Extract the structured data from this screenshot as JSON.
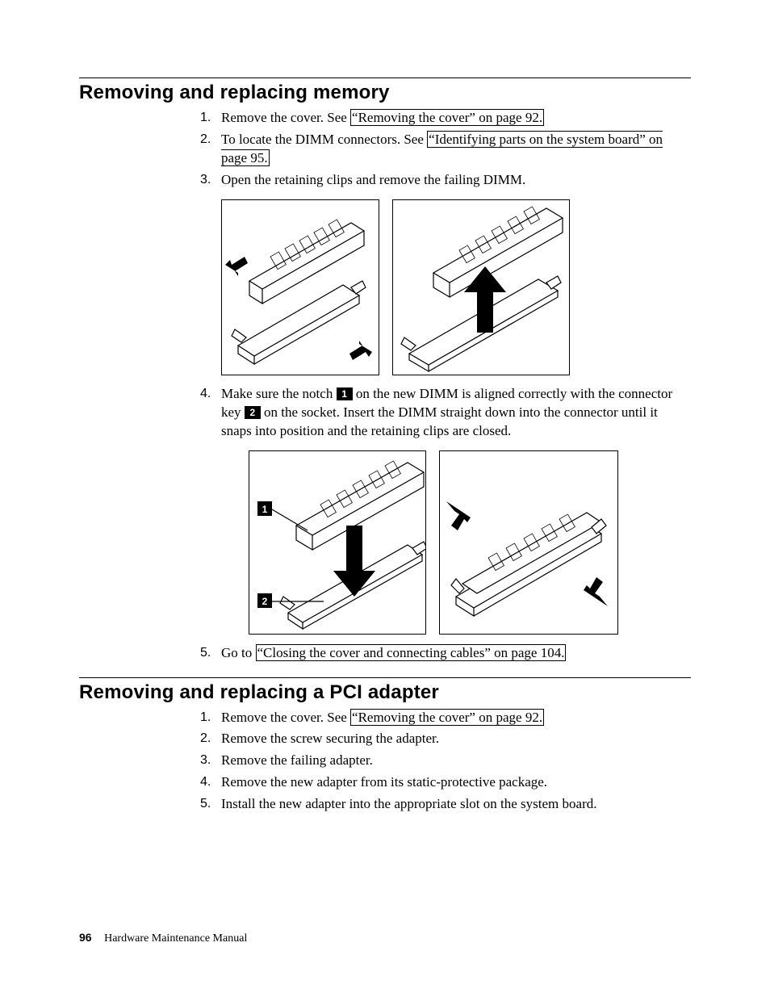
{
  "section1": {
    "heading": "Removing and replacing memory",
    "steps": {
      "s1_pre": "Remove the cover. See ",
      "s1_link": "“Removing the cover” on page 92.",
      "s2_pre": "To locate the DIMM connectors. See ",
      "s2_link": "“Identifying parts on the system board” on page 95.",
      "s3": "Open the retaining clips and remove the failing DIMM.",
      "s4_a": "Make sure the notch ",
      "s4_b": " on the new DIMM is aligned correctly with the connector key ",
      "s4_c": " on the socket. Insert the DIMM straight down into the connector until it snaps into position and the retaining clips are closed.",
      "s5_pre": "Go to ",
      "s5_link": "“Closing the cover and connecting cables” on page 104."
    },
    "callouts": {
      "c1": "1",
      "c2": "2"
    }
  },
  "section2": {
    "heading": "Removing and replacing a PCI adapter",
    "steps": {
      "s1_pre": "Remove the cover. See ",
      "s1_link": "“Removing the cover” on page 92.",
      "s2": "Remove the screw securing the adapter.",
      "s3": "Remove the failing adapter.",
      "s4": "Remove the new adapter from its static-protective package.",
      "s5": "Install the new adapter into the appropriate slot on the system board."
    }
  },
  "footer": {
    "page": "96",
    "title": "Hardware Maintenance Manual"
  },
  "nums": {
    "n1": "1.",
    "n2": "2.",
    "n3": "3.",
    "n4": "4.",
    "n5": "5."
  }
}
